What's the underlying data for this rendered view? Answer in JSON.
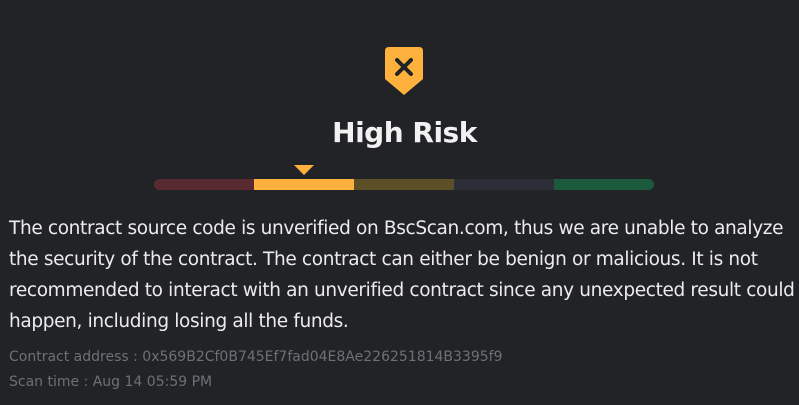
{
  "risk": {
    "title": "High Risk",
    "icon": "shield-x-icon",
    "level_index": 1,
    "accent_color": "#ffb13d",
    "scale_colors": [
      "#5a2a33",
      "#ffb13d",
      "#5c4f28",
      "#2b2e36",
      "#1c5a3e"
    ]
  },
  "description": "The contract source code is unverified on BscScan.com, thus we are unable to analyze the security of the contract. The contract can either be benign or malicious. It is not recommended to interact with an unverified contract since any unexpected result could happen, including losing all the funds.",
  "meta": {
    "contract_address_label": "Contract address : ",
    "contract_address": "0x569B2Cf0B745Ef7fad04E8Ae226251814B3395f9",
    "scan_time_label": "Scan time : ",
    "scan_time": "Aug 14 05:59 PM"
  }
}
